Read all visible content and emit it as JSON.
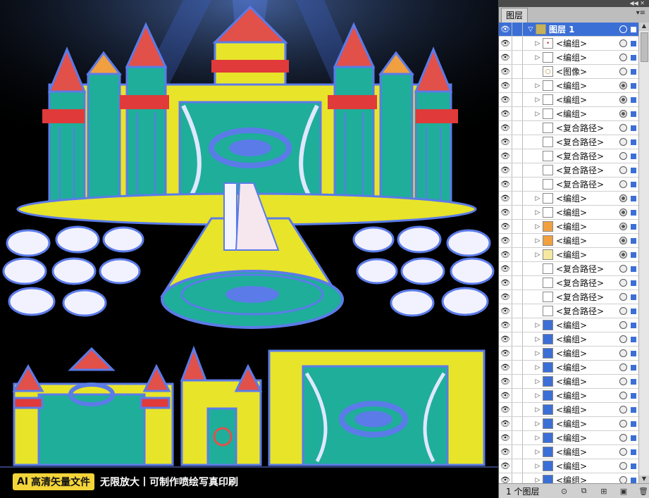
{
  "banner": {
    "tag_prefix": "AI",
    "tag_text": "高清矢量文件",
    "subtitle": "无限放大丨可制作喷绘写真印刷"
  },
  "panel": {
    "title": "图层",
    "top_layer": "图层 1",
    "layer_count": "1 个图层",
    "rows": [
      {
        "label": "<编组>",
        "expand": true,
        "thumb": "red-dot",
        "target_filled": false
      },
      {
        "label": "<编组>",
        "expand": true,
        "thumb": "blank",
        "target_filled": false
      },
      {
        "label": "<图像>",
        "expand": false,
        "thumb": "ring",
        "target_filled": false
      },
      {
        "label": "<编组>",
        "expand": true,
        "thumb": "blank",
        "target_filled": true
      },
      {
        "label": "<编组>",
        "expand": true,
        "thumb": "blank",
        "target_filled": true
      },
      {
        "label": "<编组>",
        "expand": true,
        "thumb": "blank",
        "target_filled": true
      },
      {
        "label": "<复合路径>",
        "expand": false,
        "thumb": "blank",
        "target_filled": false
      },
      {
        "label": "<复合路径>",
        "expand": false,
        "thumb": "blank",
        "target_filled": false
      },
      {
        "label": "<复合路径>",
        "expand": false,
        "thumb": "blank",
        "target_filled": false
      },
      {
        "label": "<复合路径>",
        "expand": false,
        "thumb": "blank",
        "target_filled": false
      },
      {
        "label": "<复合路径>",
        "expand": false,
        "thumb": "blank",
        "target_filled": false
      },
      {
        "label": "<编组>",
        "expand": true,
        "thumb": "blank",
        "target_filled": true
      },
      {
        "label": "<编组>",
        "expand": true,
        "thumb": "blank",
        "target_filled": true
      },
      {
        "label": "<编组>",
        "expand": true,
        "thumb": "orange",
        "target_filled": true
      },
      {
        "label": "<编组>",
        "expand": true,
        "thumb": "orange",
        "target_filled": true
      },
      {
        "label": "<编组>",
        "expand": true,
        "thumb": "yellow",
        "target_filled": true
      },
      {
        "label": "<复合路径>",
        "expand": false,
        "thumb": "blank",
        "target_filled": false
      },
      {
        "label": "<复合路径>",
        "expand": false,
        "thumb": "blank",
        "target_filled": false
      },
      {
        "label": "<复合路径>",
        "expand": false,
        "thumb": "blank",
        "target_filled": false
      },
      {
        "label": "<复合路径>",
        "expand": false,
        "thumb": "blank",
        "target_filled": false
      },
      {
        "label": "<编组>",
        "expand": true,
        "thumb": "blue",
        "target_filled": false
      },
      {
        "label": "<编组>",
        "expand": true,
        "thumb": "blue",
        "target_filled": false
      },
      {
        "label": "<编组>",
        "expand": true,
        "thumb": "blue",
        "target_filled": false
      },
      {
        "label": "<编组>",
        "expand": true,
        "thumb": "blue",
        "target_filled": false
      },
      {
        "label": "<编组>",
        "expand": true,
        "thumb": "blue",
        "target_filled": false
      },
      {
        "label": "<编组>",
        "expand": true,
        "thumb": "blue",
        "target_filled": false
      },
      {
        "label": "<编组>",
        "expand": true,
        "thumb": "blue",
        "target_filled": false
      },
      {
        "label": "<编组>",
        "expand": true,
        "thumb": "blue",
        "target_filled": false
      },
      {
        "label": "<编组>",
        "expand": true,
        "thumb": "blue",
        "target_filled": false
      },
      {
        "label": "<编组>",
        "expand": true,
        "thumb": "blue",
        "target_filled": false
      },
      {
        "label": "<编组>",
        "expand": true,
        "thumb": "blue",
        "target_filled": false
      },
      {
        "label": "<编组>",
        "expand": true,
        "thumb": "blue",
        "target_filled": false
      }
    ]
  },
  "colors": {
    "wire_blue": "#5b7be8",
    "fill_yellow": "#e8e42a",
    "fill_teal": "#1fae9a",
    "roof_red": "#e2504a",
    "roof_orange": "#f0a040",
    "accent_red": "#e03a3a",
    "selection_blue": "#3b6fd6"
  }
}
